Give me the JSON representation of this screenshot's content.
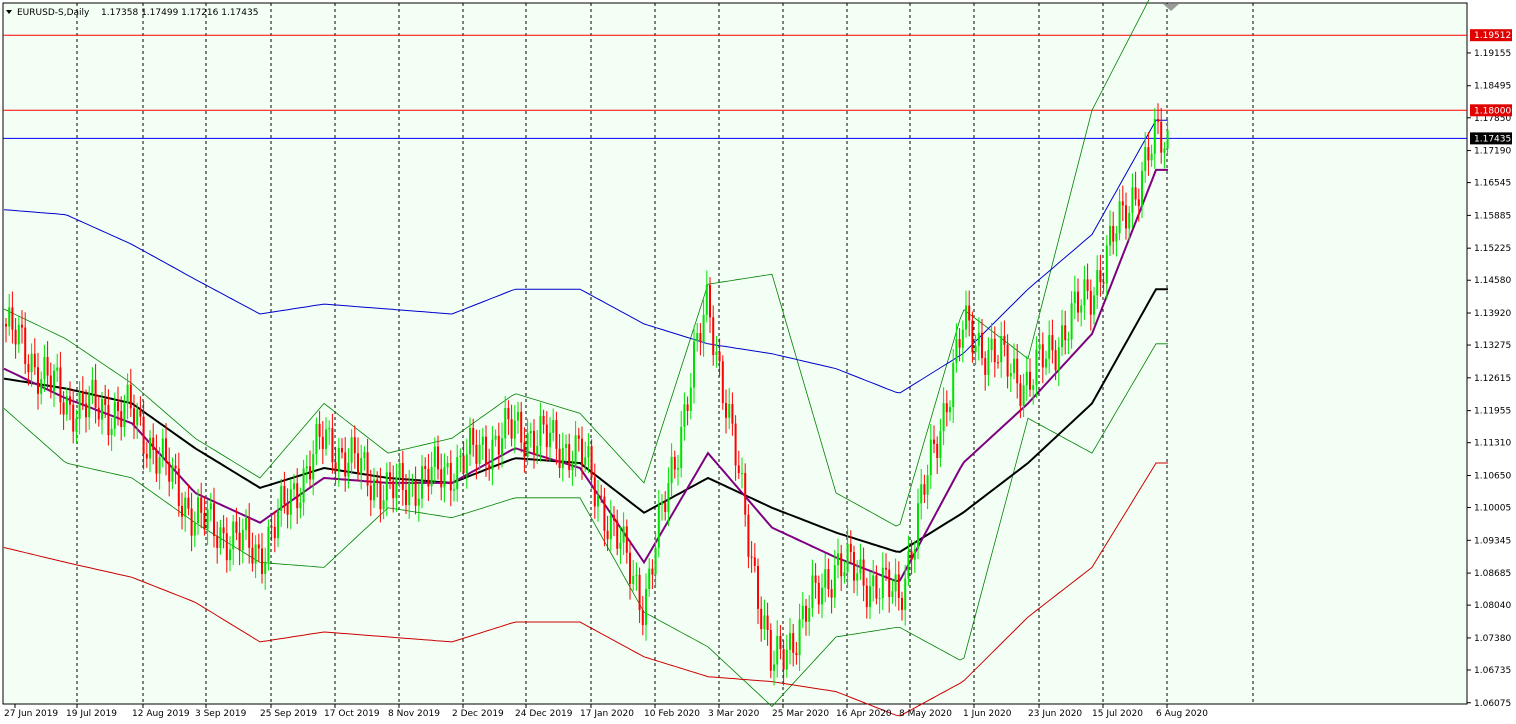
{
  "header": {
    "symbol": "EURUSD-S,Daily",
    "ohlc": "1.17358 1.17499 1.17216 1.17435"
  },
  "colors": {
    "background": "#f3fff5",
    "bull": "#00e000",
    "bear": "#ff0000",
    "ma_fast": "#800080",
    "ma_slow": "#000000",
    "envelope": "#008000",
    "upper_long": "#0000cc",
    "lower_long": "#cc0000",
    "hline_red": "#ff0000",
    "hline_blue": "#0000ff"
  },
  "chart_data": {
    "type": "candlestick",
    "ylim": [
      1.0605,
      1.2016
    ],
    "y_ticks": [
      "1.19155",
      "1.18495",
      "1.17850",
      "1.17190",
      "1.16545",
      "1.15885",
      "1.15225",
      "1.14580",
      "1.13920",
      "1.13275",
      "1.12615",
      "1.11955",
      "1.11310",
      "1.10650",
      "1.10005",
      "1.09345",
      "1.08685",
      "1.08040",
      "1.07380",
      "1.06735",
      "1.06075"
    ],
    "x_labels": [
      "27 Jun 2019",
      "19 Jul 2019",
      "12 Aug 2019",
      "3 Sep 2019",
      "25 Sep 2019",
      "17 Oct 2019",
      "8 Nov 2019",
      "2 Dec 2019",
      "24 Dec 2019",
      "17 Jan 2020",
      "10 Feb 2020",
      "3 Mar 2020",
      "25 Mar 2020",
      "16 Apr 2020",
      "8 May 2020",
      "1 Jun 2020",
      "23 Jun 2020",
      "15 Jul 2020",
      "6 Aug 2020"
    ],
    "horizontal_lines": [
      {
        "label": "1.19512",
        "value": 1.19512,
        "color": "red"
      },
      {
        "label": "1.18000",
        "value": 1.18,
        "color": "red"
      },
      {
        "label": "1.17435",
        "value": 1.17435,
        "color": "blue"
      }
    ],
    "close_waypoints": [
      [
        "27 Jun 2019",
        1.137
      ],
      [
        "19 Jul 2019",
        1.121
      ],
      [
        "12 Aug 2019",
        1.119
      ],
      [
        "3 Sep 2019",
        1.098
      ],
      [
        "25 Sep 2019",
        1.091
      ],
      [
        "17 Oct 2019",
        1.114
      ],
      [
        "8 Nov 2019",
        1.103
      ],
      [
        "2 Dec 2019",
        1.108
      ],
      [
        "24 Dec 2019",
        1.116
      ],
      [
        "17 Jan 2020",
        1.111
      ],
      [
        "10 Feb 2020",
        1.081
      ],
      [
        "3 Mar 2020",
        1.142
      ],
      [
        "25 Mar 2020",
        1.067
      ],
      [
        "16 Apr 2020",
        1.089
      ],
      [
        "8 May 2020",
        1.082
      ],
      [
        "1 Jun 2020",
        1.136
      ],
      [
        "23 Jun 2020",
        1.125
      ],
      [
        "15 Jul 2020",
        1.144
      ],
      [
        "6 Aug 2020",
        1.174
      ]
    ],
    "ma_fast_waypoints": [
      [
        "27 Jun 2019",
        1.128
      ],
      [
        "19 Jul 2019",
        1.122
      ],
      [
        "12 Aug 2019",
        1.117
      ],
      [
        "3 Sep 2019",
        1.103
      ],
      [
        "25 Sep 2019",
        1.097
      ],
      [
        "17 Oct 2019",
        1.106
      ],
      [
        "8 Nov 2019",
        1.105
      ],
      [
        "2 Dec 2019",
        1.105
      ],
      [
        "24 Dec 2019",
        1.112
      ],
      [
        "17 Jan 2020",
        1.108
      ],
      [
        "10 Feb 2020",
        1.089
      ],
      [
        "3 Mar 2020",
        1.111
      ],
      [
        "25 Mar 2020",
        1.096
      ],
      [
        "16 Apr 2020",
        1.09
      ],
      [
        "8 May 2020",
        1.085
      ],
      [
        "1 Jun 2020",
        1.109
      ],
      [
        "23 Jun 2020",
        1.121
      ],
      [
        "15 Jul 2020",
        1.135
      ],
      [
        "6 Aug 2020",
        1.168
      ]
    ],
    "ma_slow_waypoints": [
      [
        "27 Jun 2019",
        1.126
      ],
      [
        "19 Jul 2019",
        1.124
      ],
      [
        "12 Aug 2019",
        1.121
      ],
      [
        "3 Sep 2019",
        1.112
      ],
      [
        "25 Sep 2019",
        1.104
      ],
      [
        "17 Oct 2019",
        1.108
      ],
      [
        "8 Nov 2019",
        1.106
      ],
      [
        "2 Dec 2019",
        1.105
      ],
      [
        "24 Dec 2019",
        1.11
      ],
      [
        "17 Jan 2020",
        1.109
      ],
      [
        "10 Feb 2020",
        1.099
      ],
      [
        "3 Mar 2020",
        1.106
      ],
      [
        "25 Mar 2020",
        1.1
      ],
      [
        "16 Apr 2020",
        1.095
      ],
      [
        "8 May 2020",
        1.091
      ],
      [
        "1 Jun 2020",
        1.099
      ],
      [
        "23 Jun 2020",
        1.109
      ],
      [
        "15 Jul 2020",
        1.121
      ],
      [
        "6 Aug 2020",
        1.144
      ]
    ],
    "upper_long_waypoints": [
      [
        "27 Jun 2019",
        1.16
      ],
      [
        "19 Jul 2019",
        1.159
      ],
      [
        "12 Aug 2019",
        1.153
      ],
      [
        "3 Sep 2019",
        1.146
      ],
      [
        "25 Sep 2019",
        1.139
      ],
      [
        "17 Oct 2019",
        1.141
      ],
      [
        "8 Nov 2019",
        1.14
      ],
      [
        "2 Dec 2019",
        1.139
      ],
      [
        "24 Dec 2019",
        1.144
      ],
      [
        "17 Jan 2020",
        1.144
      ],
      [
        "10 Feb 2020",
        1.137
      ],
      [
        "3 Mar 2020",
        1.133
      ],
      [
        "25 Mar 2020",
        1.131
      ],
      [
        "16 Apr 2020",
        1.128
      ],
      [
        "8 May 2020",
        1.123
      ],
      [
        "1 Jun 2020",
        1.131
      ],
      [
        "23 Jun 2020",
        1.144
      ],
      [
        "15 Jul 2020",
        1.155
      ],
      [
        "6 Aug 2020",
        1.178
      ]
    ],
    "lower_long_waypoints": [
      [
        "27 Jun 2019",
        1.092
      ],
      [
        "19 Jul 2019",
        1.089
      ],
      [
        "12 Aug 2019",
        1.086
      ],
      [
        "3 Sep 2019",
        1.081
      ],
      [
        "25 Sep 2019",
        1.073
      ],
      [
        "17 Oct 2019",
        1.075
      ],
      [
        "8 Nov 2019",
        1.074
      ],
      [
        "2 Dec 2019",
        1.073
      ],
      [
        "24 Dec 2019",
        1.077
      ],
      [
        "17 Jan 2020",
        1.077
      ],
      [
        "10 Feb 2020",
        1.07
      ],
      [
        "3 Mar 2020",
        1.066
      ],
      [
        "25 Mar 2020",
        1.065
      ],
      [
        "16 Apr 2020",
        1.063
      ],
      [
        "8 May 2020",
        1.058
      ],
      [
        "1 Jun 2020",
        1.065
      ],
      [
        "23 Jun 2020",
        1.078
      ],
      [
        "15 Jul 2020",
        1.088
      ],
      [
        "6 Aug 2020",
        1.109
      ]
    ],
    "upper_band_waypoints": [
      [
        "27 Jun 2019",
        1.14
      ],
      [
        "19 Jul 2019",
        1.134
      ],
      [
        "12 Aug 2019",
        1.125
      ],
      [
        "3 Sep 2019",
        1.114
      ],
      [
        "25 Sep 2019",
        1.106
      ],
      [
        "17 Oct 2019",
        1.121
      ],
      [
        "8 Nov 2019",
        1.111
      ],
      [
        "2 Dec 2019",
        1.114
      ],
      [
        "24 Dec 2019",
        1.123
      ],
      [
        "17 Jan 2020",
        1.119
      ],
      [
        "10 Feb 2020",
        1.105
      ],
      [
        "3 Mar 2020",
        1.145
      ],
      [
        "25 Mar 2020",
        1.147
      ],
      [
        "16 Apr 2020",
        1.103
      ],
      [
        "8 May 2020",
        1.096
      ],
      [
        "1 Jun 2020",
        1.14
      ],
      [
        "23 Jun 2020",
        1.13
      ],
      [
        "15 Jul 2020",
        1.18
      ],
      [
        "6 Aug 2020",
        1.205
      ]
    ],
    "lower_band_waypoints": [
      [
        "27 Jun 2019",
        1.12
      ],
      [
        "19 Jul 2019",
        1.109
      ],
      [
        "12 Aug 2019",
        1.106
      ],
      [
        "3 Sep 2019",
        1.097
      ],
      [
        "25 Sep 2019",
        1.089
      ],
      [
        "17 Oct 2019",
        1.088
      ],
      [
        "8 Nov 2019",
        1.1
      ],
      [
        "2 Dec 2019",
        1.098
      ],
      [
        "24 Dec 2019",
        1.102
      ],
      [
        "17 Jan 2020",
        1.102
      ],
      [
        "10 Feb 2020",
        1.079
      ],
      [
        "3 Mar 2020",
        1.072
      ],
      [
        "25 Mar 2020",
        1.06
      ],
      [
        "16 Apr 2020",
        1.074
      ],
      [
        "8 May 2020",
        1.076
      ],
      [
        "1 Jun 2020",
        1.069
      ],
      [
        "23 Jun 2020",
        1.118
      ],
      [
        "15 Jul 2020",
        1.111
      ],
      [
        "6 Aug 2020",
        1.133
      ]
    ]
  }
}
